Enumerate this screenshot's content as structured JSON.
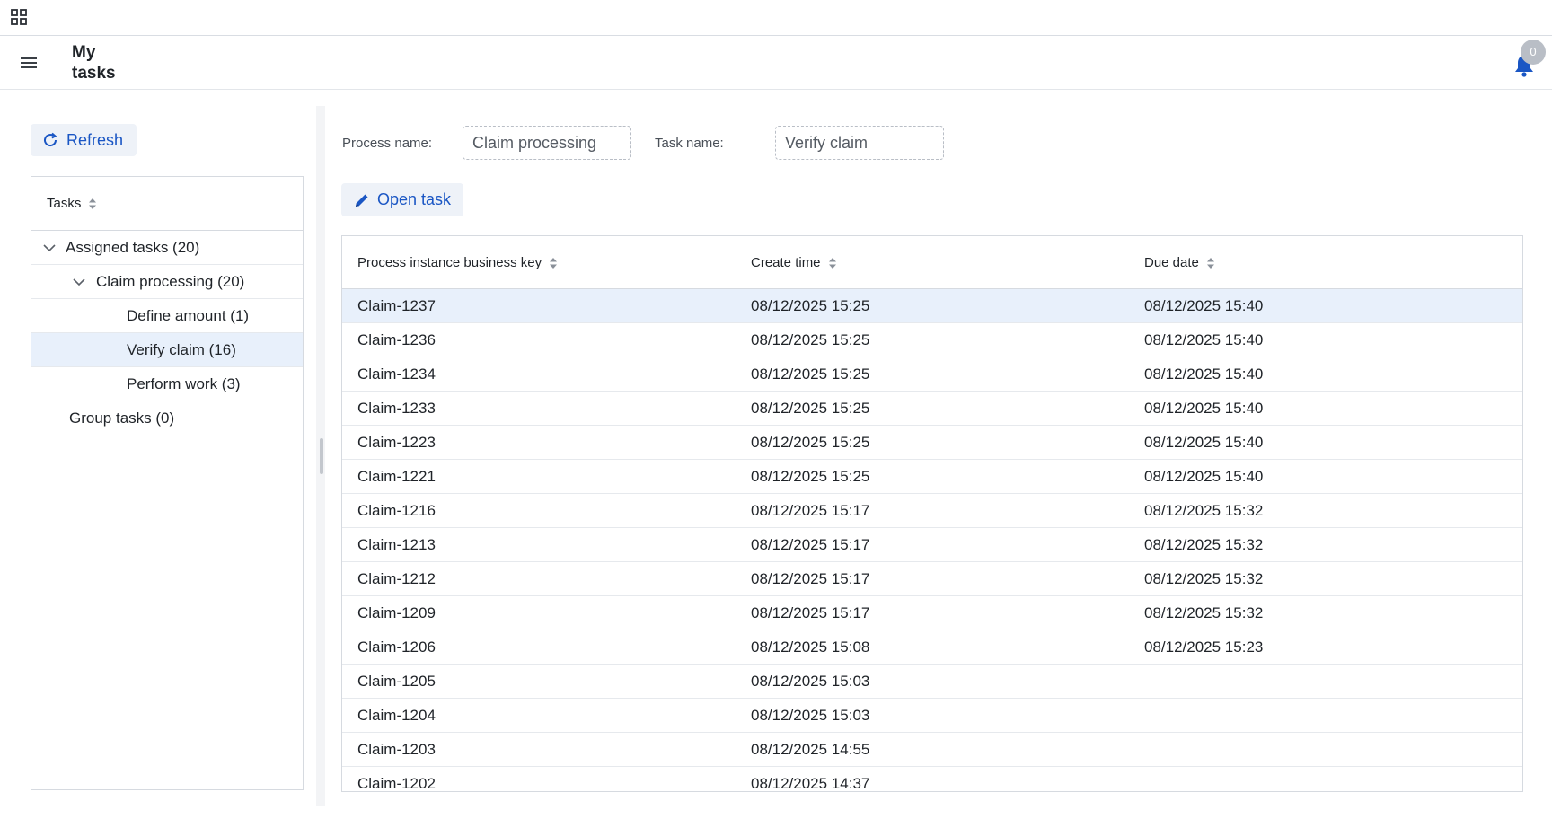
{
  "header": {
    "title": "My tasks",
    "notification_count": "0"
  },
  "left": {
    "refresh_label": "Refresh",
    "tree_header": "Tasks",
    "tree": [
      {
        "label": "Assigned tasks (20)",
        "level": 0,
        "expanded": true,
        "selected": false
      },
      {
        "label": "Claim processing (20)",
        "level": 1,
        "expanded": true,
        "selected": false
      },
      {
        "label": "Define amount (1)",
        "level": 2,
        "selected": false
      },
      {
        "label": "Verify claim (16)",
        "level": 2,
        "selected": true
      },
      {
        "label": "Perform work (3)",
        "level": 2,
        "selected": false
      },
      {
        "label": "Group tasks (0)",
        "level": 0,
        "selected": false
      }
    ]
  },
  "filters": {
    "process_label": "Process name:",
    "process_value": "Claim processing",
    "task_label": "Task name:",
    "task_value": "Verify claim"
  },
  "toolbar": {
    "open_task_label": "Open task"
  },
  "grid": {
    "columns": [
      "Process instance business key",
      "Create time",
      "Due date"
    ],
    "rows": [
      [
        "Claim-1237",
        "08/12/2025 15:25",
        "08/12/2025 15:40"
      ],
      [
        "Claim-1236",
        "08/12/2025 15:25",
        "08/12/2025 15:40"
      ],
      [
        "Claim-1234",
        "08/12/2025 15:25",
        "08/12/2025 15:40"
      ],
      [
        "Claim-1233",
        "08/12/2025 15:25",
        "08/12/2025 15:40"
      ],
      [
        "Claim-1223",
        "08/12/2025 15:25",
        "08/12/2025 15:40"
      ],
      [
        "Claim-1221",
        "08/12/2025 15:25",
        "08/12/2025 15:40"
      ],
      [
        "Claim-1216",
        "08/12/2025 15:17",
        "08/12/2025 15:32"
      ],
      [
        "Claim-1213",
        "08/12/2025 15:17",
        "08/12/2025 15:32"
      ],
      [
        "Claim-1212",
        "08/12/2025 15:17",
        "08/12/2025 15:32"
      ],
      [
        "Claim-1209",
        "08/12/2025 15:17",
        "08/12/2025 15:32"
      ],
      [
        "Claim-1206",
        "08/12/2025 15:08",
        "08/12/2025 15:23"
      ],
      [
        "Claim-1205",
        "08/12/2025 15:03",
        ""
      ],
      [
        "Claim-1204",
        "08/12/2025 15:03",
        ""
      ],
      [
        "Claim-1203",
        "08/12/2025 14:55",
        ""
      ],
      [
        "Claim-1202",
        "08/12/2025 14:37",
        ""
      ]
    ],
    "selected_row": 0
  },
  "colors": {
    "accent": "#1a56c4",
    "selection": "#e8f0fb",
    "button_bg": "#eef2f8"
  }
}
